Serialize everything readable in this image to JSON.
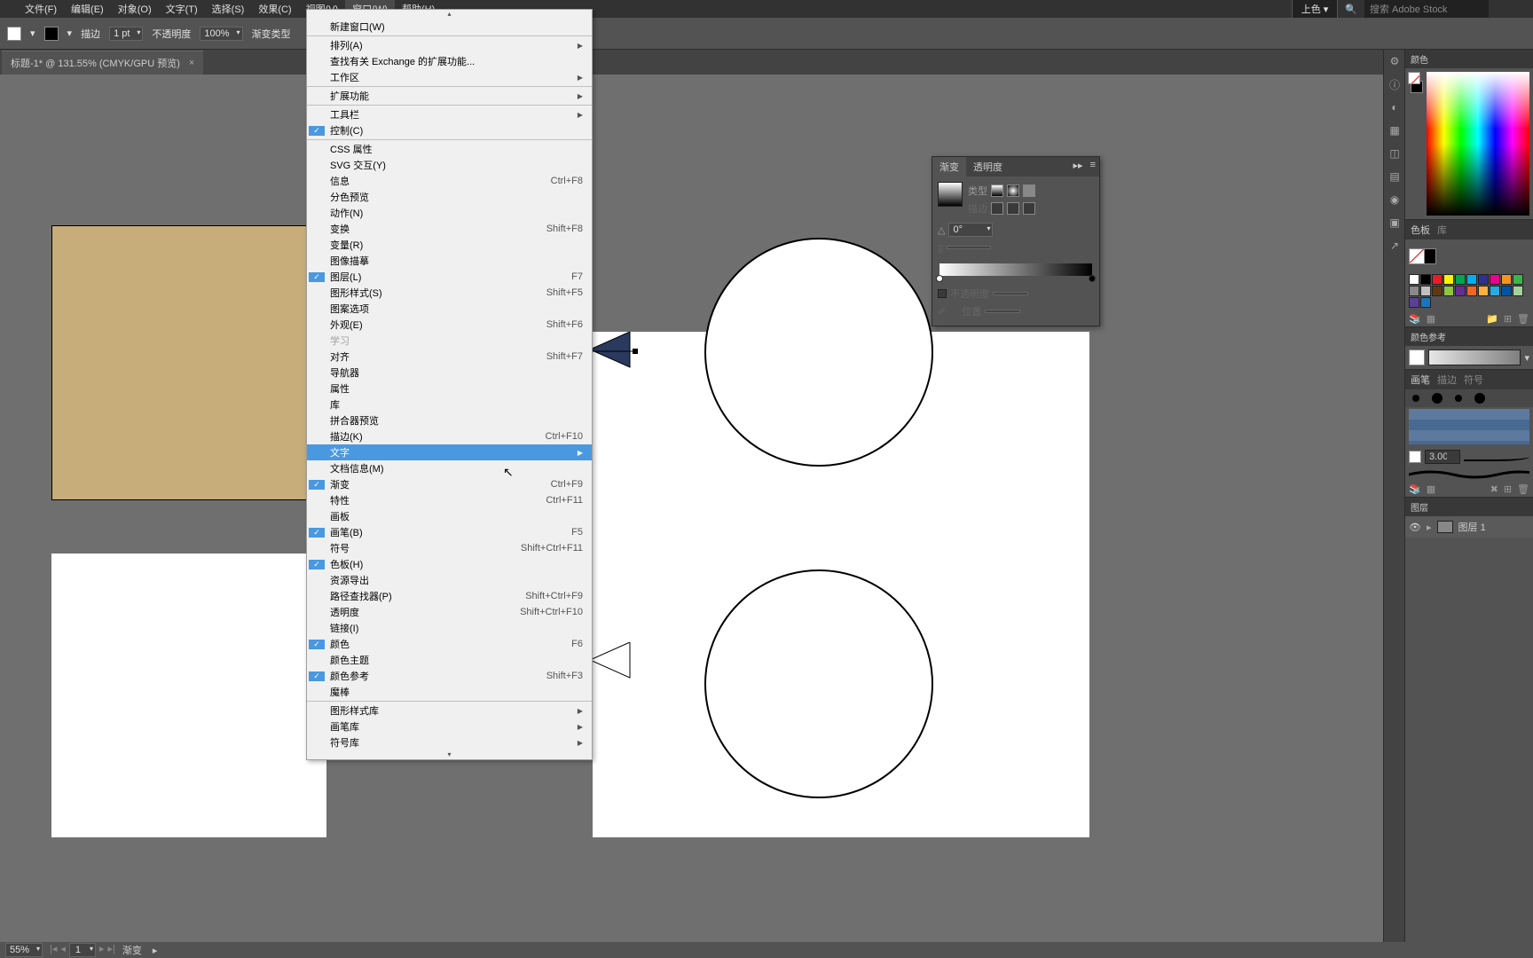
{
  "menubar": {
    "items": [
      "文件(F)",
      "编辑(E)",
      "对象(O)",
      "文字(T)",
      "选择(S)",
      "效果(C)",
      "视图(V)",
      "窗口(W)",
      "帮助(H)"
    ],
    "right_label": "上色",
    "search_placeholder": "搜索 Adobe Stock"
  },
  "optbar": {
    "stroke_label": "描边",
    "stroke_val": "1 pt",
    "opacity_label": "不透明度",
    "opacity_val": "100%",
    "gradient_type": "渐变类型"
  },
  "tab": {
    "title": "标题-1* @ 131.55% (CMYK/GPU 预览)"
  },
  "ddmenu": [
    {
      "type": "arrowtop"
    },
    {
      "label": "新建窗口(W)"
    },
    {
      "sep": true
    },
    {
      "label": "排列(A)",
      "arr": true
    },
    {
      "label": "查找有关 Exchange 的扩展功能..."
    },
    {
      "label": "工作区",
      "arr": true
    },
    {
      "sep": true
    },
    {
      "label": "扩展功能",
      "arr": true
    },
    {
      "sep": true
    },
    {
      "label": "工具栏",
      "arr": true
    },
    {
      "label": "控制(C)",
      "chk": true
    },
    {
      "sep": true
    },
    {
      "label": "CSS 属性"
    },
    {
      "label": "SVG 交互(Y)"
    },
    {
      "label": "信息",
      "sc": "Ctrl+F8"
    },
    {
      "label": "分色预览"
    },
    {
      "label": "动作(N)"
    },
    {
      "label": "变换",
      "sc": "Shift+F8"
    },
    {
      "label": "变量(R)"
    },
    {
      "label": "图像描摹"
    },
    {
      "label": "图层(L)",
      "sc": "F7",
      "chk": true
    },
    {
      "label": "图形样式(S)",
      "sc": "Shift+F5"
    },
    {
      "label": "图案选项"
    },
    {
      "label": "外观(E)",
      "sc": "Shift+F6"
    },
    {
      "label": "学习",
      "disabled": true
    },
    {
      "label": "对齐",
      "sc": "Shift+F7"
    },
    {
      "label": "导航器"
    },
    {
      "label": "属性"
    },
    {
      "label": "库"
    },
    {
      "label": "拼合器预览"
    },
    {
      "label": "描边(K)",
      "sc": "Ctrl+F10"
    },
    {
      "label": "文字",
      "arr": true,
      "hov": true
    },
    {
      "label": "文档信息(M)"
    },
    {
      "label": "渐变",
      "sc": "Ctrl+F9",
      "chk": true
    },
    {
      "label": "特性",
      "sc": "Ctrl+F11"
    },
    {
      "label": "画板"
    },
    {
      "label": "画笔(B)",
      "sc": "F5",
      "chk": true
    },
    {
      "label": "符号",
      "sc": "Shift+Ctrl+F11"
    },
    {
      "label": "色板(H)",
      "chk": true
    },
    {
      "label": "资源导出"
    },
    {
      "label": "路径查找器(P)",
      "sc": "Shift+Ctrl+F9"
    },
    {
      "label": "透明度",
      "sc": "Shift+Ctrl+F10"
    },
    {
      "label": "链接(I)"
    },
    {
      "label": "颜色",
      "sc": "F6",
      "chk": true
    },
    {
      "label": "颜色主题"
    },
    {
      "label": "颜色参考",
      "sc": "Shift+F3",
      "chk": true
    },
    {
      "label": "魔棒"
    },
    {
      "sep": true
    },
    {
      "label": "图形样式库",
      "arr": true
    },
    {
      "label": "画笔库",
      "arr": true
    },
    {
      "label": "符号库",
      "arr": true
    },
    {
      "type": "arrowbot"
    }
  ],
  "gradpanel": {
    "tab1": "渐变",
    "tab2": "透明度",
    "type_label": "类型",
    "angle_label": "△",
    "angle_val": "0°",
    "opacity_label": "不透明度",
    "loc_label": "位置"
  },
  "rightpanels": {
    "color": "颜色",
    "swatches_tab1": "色板",
    "swatches_tab2": "库",
    "colorguide": "颜色参考",
    "brush_tab1": "画笔",
    "brush_tab2": "描边",
    "brush_tab3": "符号",
    "brush_size": "3.00",
    "layers": "图层",
    "layer1": "图层 1"
  },
  "status": {
    "zoom": "55%",
    "page": "1",
    "tool": "渐变"
  },
  "swatch_colors": [
    "#ffffff",
    "#000000",
    "#ed1c24",
    "#fff200",
    "#00a651",
    "#00aeef",
    "#2e3192",
    "#ec008c",
    "#f7941d",
    "#39b54a",
    "#898989",
    "#c0c0c0",
    "#603913",
    "#8dc63f",
    "#662d91",
    "#f26522",
    "#fbb040",
    "#29abe2",
    "#0054a6",
    "#a3d39c",
    "#5a4099",
    "#1c75bc"
  ]
}
